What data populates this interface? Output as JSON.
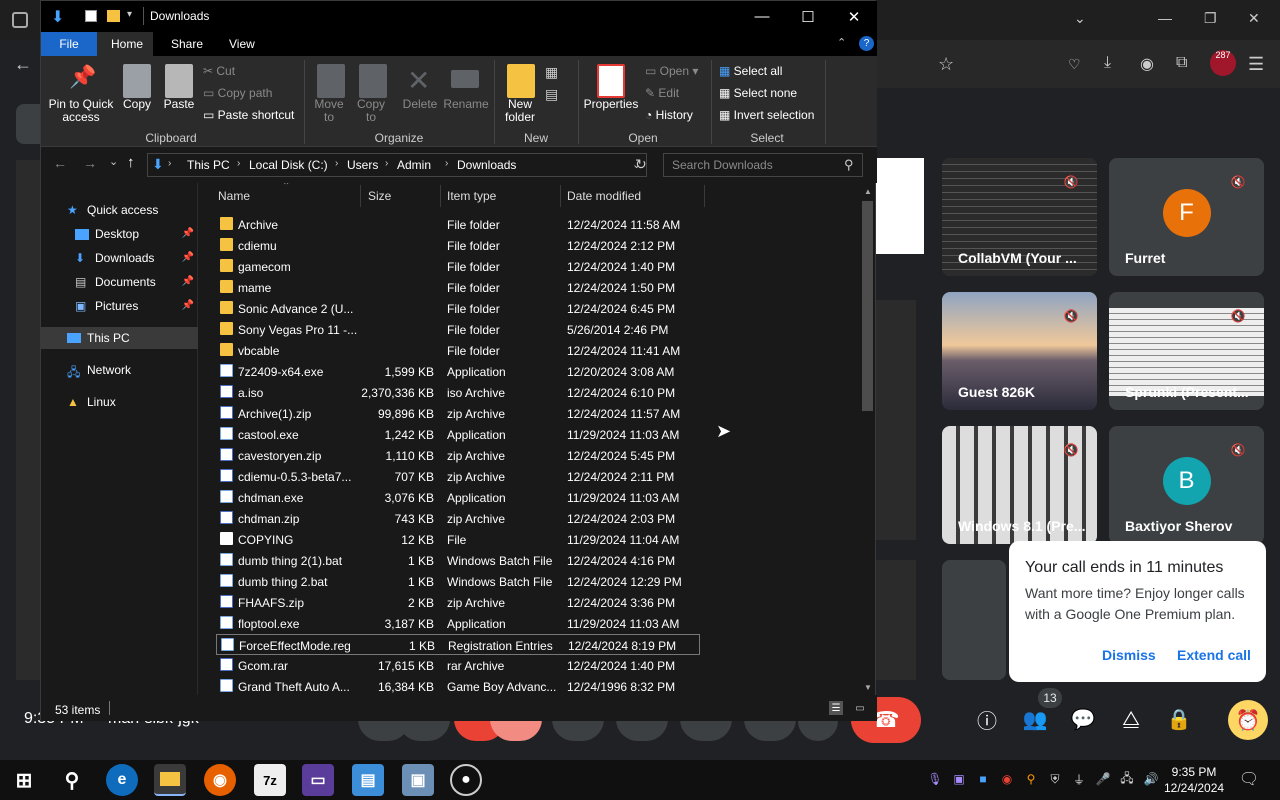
{
  "window": {
    "title": "Downloads",
    "min": "—",
    "max": "☐",
    "close": "✕"
  },
  "ribbon": {
    "tabs": [
      "File",
      "Home",
      "Share",
      "View"
    ],
    "clipboard": {
      "pin": "Pin to Quick access",
      "copy": "Copy",
      "paste": "Paste",
      "cut": "Cut",
      "copy_path": "Copy path",
      "paste_shortcut": "Paste shortcut",
      "group": "Clipboard"
    },
    "organize": {
      "move_to": "Move to",
      "copy_to": "Copy to",
      "delete": "Delete",
      "rename": "Rename",
      "group": "Organize"
    },
    "new": {
      "new_folder": "New folder",
      "group": "New"
    },
    "open": {
      "properties": "Properties",
      "open": "Open",
      "edit": "Edit",
      "history": "History",
      "group": "Open"
    },
    "select": {
      "select_all": "Select all",
      "select_none": "Select none",
      "invert": "Invert selection",
      "group": "Select"
    }
  },
  "address": {
    "crumbs": [
      "This PC",
      "Local Disk (C:)",
      "Users",
      "Admin",
      "Downloads"
    ],
    "search_placeholder": "Search Downloads"
  },
  "nav": {
    "quick_access": "Quick access",
    "pinned": [
      "Desktop",
      "Downloads",
      "Documents",
      "Pictures"
    ],
    "this_pc": "This PC",
    "network": "Network",
    "linux": "Linux"
  },
  "columns": [
    "Name",
    "Size",
    "Item type",
    "Date modified"
  ],
  "files": [
    {
      "name": "Archive",
      "size": "",
      "type": "File folder",
      "date": "12/24/2024 11:58 AM",
      "kind": "folder"
    },
    {
      "name": "cdiemu",
      "size": "",
      "type": "File folder",
      "date": "12/24/2024 2:12 PM",
      "kind": "folder"
    },
    {
      "name": "gamecom",
      "size": "",
      "type": "File folder",
      "date": "12/24/2024 1:40 PM",
      "kind": "folder"
    },
    {
      "name": "mame",
      "size": "",
      "type": "File folder",
      "date": "12/24/2024 1:50 PM",
      "kind": "folder"
    },
    {
      "name": "Sonic Advance 2 (U...",
      "size": "",
      "type": "File folder",
      "date": "12/24/2024 6:45 PM",
      "kind": "folder"
    },
    {
      "name": "Sony Vegas Pro 11 -...",
      "size": "",
      "type": "File folder",
      "date": "5/26/2014 2:46 PM",
      "kind": "folder"
    },
    {
      "name": "vbcable",
      "size": "",
      "type": "File folder",
      "date": "12/24/2024 11:41 AM",
      "kind": "folder"
    },
    {
      "name": "7z2409-x64.exe",
      "size": "1,599 KB",
      "type": "Application",
      "date": "12/20/2024 3:08 AM",
      "kind": "app"
    },
    {
      "name": "a.iso",
      "size": "2,370,336 KB",
      "type": "iso Archive",
      "date": "12/24/2024 6:10 PM",
      "kind": "arch"
    },
    {
      "name": "Archive(1).zip",
      "size": "99,896 KB",
      "type": "zip Archive",
      "date": "12/24/2024 11:57 AM",
      "kind": "arch"
    },
    {
      "name": "castool.exe",
      "size": "1,242 KB",
      "type": "Application",
      "date": "11/29/2024 11:03 AM",
      "kind": "app"
    },
    {
      "name": "cavestoryen.zip",
      "size": "1,110 KB",
      "type": "zip Archive",
      "date": "12/24/2024 5:45 PM",
      "kind": "arch"
    },
    {
      "name": "cdiemu-0.5.3-beta7...",
      "size": "707 KB",
      "type": "zip Archive",
      "date": "12/24/2024 2:11 PM",
      "kind": "arch"
    },
    {
      "name": "chdman.exe",
      "size": "3,076 KB",
      "type": "Application",
      "date": "11/29/2024 11:03 AM",
      "kind": "app"
    },
    {
      "name": "chdman.zip",
      "size": "743 KB",
      "type": "zip Archive",
      "date": "12/24/2024 2:03 PM",
      "kind": "arch"
    },
    {
      "name": "COPYING",
      "size": "12 KB",
      "type": "File",
      "date": "11/29/2024 11:04 AM",
      "kind": "file"
    },
    {
      "name": "dumb thing 2(1).bat",
      "size": "1 KB",
      "type": "Windows Batch File",
      "date": "12/24/2024 4:16 PM",
      "kind": "app"
    },
    {
      "name": "dumb thing 2.bat",
      "size": "1 KB",
      "type": "Windows Batch File",
      "date": "12/24/2024 12:29 PM",
      "kind": "app"
    },
    {
      "name": "FHAAFS.zip",
      "size": "2 KB",
      "type": "zip Archive",
      "date": "12/24/2024 3:36 PM",
      "kind": "arch"
    },
    {
      "name": "floptool.exe",
      "size": "3,187 KB",
      "type": "Application",
      "date": "11/29/2024 11:03 AM",
      "kind": "app"
    },
    {
      "name": "ForceEffectMode.reg",
      "size": "1 KB",
      "type": "Registration Entries",
      "date": "12/24/2024 8:19 PM",
      "kind": "app"
    },
    {
      "name": "Gcom.rar",
      "size": "17,615 KB",
      "type": "rar Archive",
      "date": "12/24/2024 1:40 PM",
      "kind": "arch"
    },
    {
      "name": "Grand Theft Auto A...",
      "size": "16,384 KB",
      "type": "Game Boy Advanc...",
      "date": "12/24/1996 8:32 PM",
      "kind": "app"
    }
  ],
  "selected_row": 20,
  "status": {
    "items": "53 items"
  },
  "meet": {
    "tiles": [
      {
        "name": "CollabVM (Your ...",
        "kind": "screen"
      },
      {
        "name": "Furret",
        "initial": "F",
        "color": "#e8710a"
      },
      {
        "name": "Guest 826K",
        "kind": "landscape"
      },
      {
        "name": "Sprunki (Present...",
        "kind": "screen"
      },
      {
        "name": "Windows 8.1 (Pre...",
        "kind": "screen"
      },
      {
        "name": "Baxtiyor Sherov",
        "initial": "B",
        "color": "#12a4af"
      }
    ],
    "clock": "9:35 PM",
    "code": "man-sibk-jgk",
    "people_count": "13",
    "popup": {
      "title": "Your call ends in 11 minutes",
      "body": "Want more time? Enjoy longer calls with a Google One Premium plan.",
      "dismiss": "Dismiss",
      "extend": "Extend call"
    },
    "chrome_badge": "287"
  },
  "taskbar": {
    "time": "9:35 PM",
    "date": "12/24/2024",
    "seven_zip": "7z"
  },
  "colors": {
    "accent": "#1a66c9",
    "leave": "#ea4335",
    "timer": "#fdd663",
    "folder": "#f5c242"
  }
}
